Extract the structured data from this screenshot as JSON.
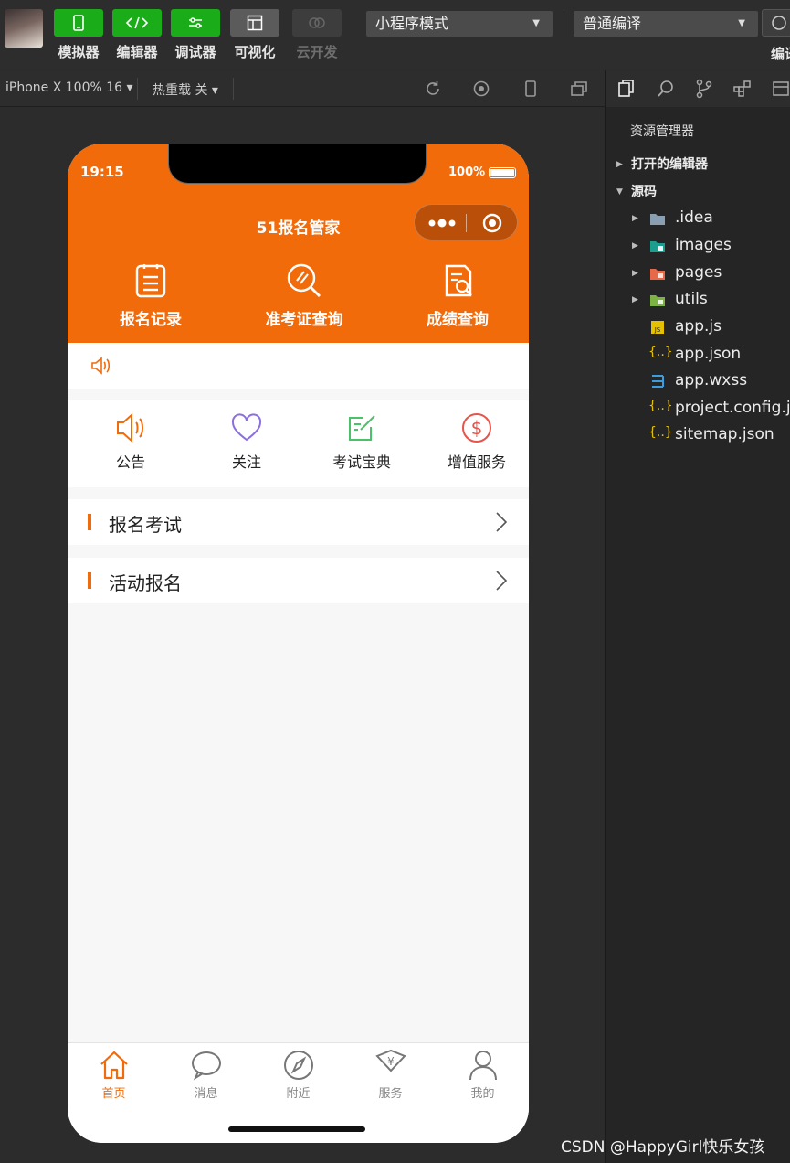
{
  "toolbar": {
    "tools": [
      {
        "label": "模拟器",
        "icon": "phone-icon",
        "state": "active"
      },
      {
        "label": "编辑器",
        "icon": "code-icon",
        "state": "active"
      },
      {
        "label": "调试器",
        "icon": "debug-icon",
        "state": "active"
      },
      {
        "label": "可视化",
        "icon": "layout-icon",
        "state": "normal"
      },
      {
        "label": "云开发",
        "icon": "cloud-icon",
        "state": "disabled"
      }
    ],
    "mode_select": "小程序模式",
    "compile_select": "普通编译",
    "compile_label": "编译"
  },
  "simulator": {
    "device": "iPhone X 100% 16 ▾",
    "hot_reload": "热重载 关 ▾"
  },
  "explorer": {
    "title": "资源管理器",
    "sections": {
      "open_editors": "打开的编辑器",
      "source": "源码"
    },
    "items": [
      {
        "name": ".idea",
        "type": "folder",
        "icon": "folder-icon"
      },
      {
        "name": "images",
        "type": "folder",
        "icon": "images-folder-icon"
      },
      {
        "name": "pages",
        "type": "folder",
        "icon": "pages-folder-icon"
      },
      {
        "name": "utils",
        "type": "folder",
        "icon": "utils-folder-icon"
      },
      {
        "name": "app.js",
        "type": "file",
        "icon": "js-file-icon"
      },
      {
        "name": "app.json",
        "type": "file",
        "icon": "json-file-icon"
      },
      {
        "name": "app.wxss",
        "type": "file",
        "icon": "css-file-icon"
      },
      {
        "name": "project.config.json",
        "type": "file",
        "icon": "json-file-icon"
      },
      {
        "name": "sitemap.json",
        "type": "file",
        "icon": "json-file-icon"
      }
    ]
  },
  "phone": {
    "status": {
      "time": "19:15",
      "battery": "100%"
    },
    "nav_title": "51报名管家",
    "quick_actions": [
      {
        "label": "报名记录",
        "icon": "record-icon"
      },
      {
        "label": "准考证查询",
        "icon": "search-icon"
      },
      {
        "label": "成绩查询",
        "icon": "score-icon"
      }
    ],
    "notice": {
      "icon": "speaker-icon",
      "text": ""
    },
    "categories": [
      {
        "label": "公告",
        "icon": "speaker-icon"
      },
      {
        "label": "关注",
        "icon": "heart-icon"
      },
      {
        "label": "考试宝典",
        "icon": "edit-icon"
      },
      {
        "label": "增值服务",
        "icon": "dollar-icon"
      }
    ],
    "list": [
      {
        "title": "报名考试"
      },
      {
        "title": "活动报名"
      }
    ],
    "tabs": [
      {
        "label": "首页",
        "icon": "home-icon",
        "active": true
      },
      {
        "label": "消息",
        "icon": "message-icon",
        "active": false
      },
      {
        "label": "附近",
        "icon": "compass-icon",
        "active": false
      },
      {
        "label": "服务",
        "icon": "service-icon",
        "active": false
      },
      {
        "label": "我的",
        "icon": "user-icon",
        "active": false
      }
    ]
  },
  "colors": {
    "brand": "#f26b0b",
    "tool_green": "#1aad19",
    "background": "#2c2c2c"
  },
  "watermark": "CSDN @HappyGirl快乐女孩"
}
